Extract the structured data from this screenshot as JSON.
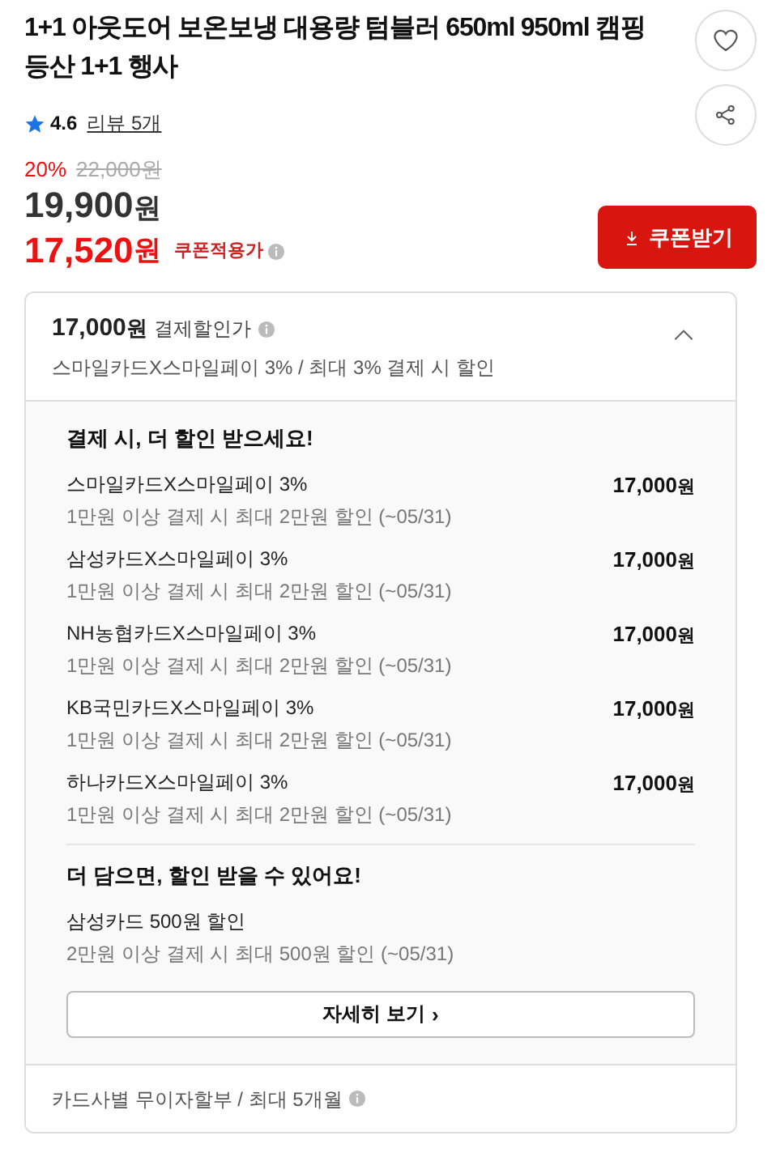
{
  "product": {
    "title": "1+1 아웃도어 보온보냉 대용량 텀블러 650ml 950ml 캠핑 등산 1+1 행사",
    "liked": false
  },
  "rating": {
    "score": "4.6",
    "reviews": "리뷰 5개"
  },
  "price": {
    "discount": "20%",
    "original": "22,000원",
    "sale_amount": "19,900",
    "sale_unit": "원",
    "coupon_amount": "17,520",
    "coupon_unit": "원",
    "coupon_label": "쿠폰적용가"
  },
  "coupon_button": {
    "label": "쿠폰받기"
  },
  "payment_discount": {
    "expanded": true,
    "amount": "17,000",
    "unit": "원",
    "label": "결제할인가",
    "summary": "스마일카드X스마일페이 3% / 최대 3% 결제 시 할인",
    "heading": "결제 시, 더 할인 받으세요!",
    "offers": [
      {
        "name": "스마일카드X스마일페이 3%",
        "condition": "1만원 이상 결제 시 최대 2만원 할인 (~05/31)",
        "amount": "17,000",
        "unit": "원"
      },
      {
        "name": "삼성카드X스마일페이 3%",
        "condition": "1만원 이상 결제 시 최대 2만원 할인 (~05/31)",
        "amount": "17,000",
        "unit": "원"
      },
      {
        "name": "NH농협카드X스마일페이 3%",
        "condition": "1만원 이상 결제 시 최대 2만원 할인 (~05/31)",
        "amount": "17,000",
        "unit": "원"
      },
      {
        "name": "KB국민카드X스마일페이 3%",
        "condition": "1만원 이상 결제 시 최대 2만원 할인 (~05/31)",
        "amount": "17,000",
        "unit": "원"
      },
      {
        "name": "하나카드X스마일페이 3%",
        "condition": "1만원 이상 결제 시 최대 2만원 할인 (~05/31)",
        "amount": "17,000",
        "unit": "원"
      }
    ],
    "more_heading": "더 담으면, 할인 받을 수 있어요!",
    "more_offers": [
      {
        "name": "삼성카드 500원 할인",
        "condition": "2만원 이상 결제 시 최대 500원 할인 (~05/31)"
      }
    ],
    "details_button": "자세히 보기",
    "details_arrow": "›",
    "installment": "카드사별 무이자할부 / 최대 5개월"
  }
}
